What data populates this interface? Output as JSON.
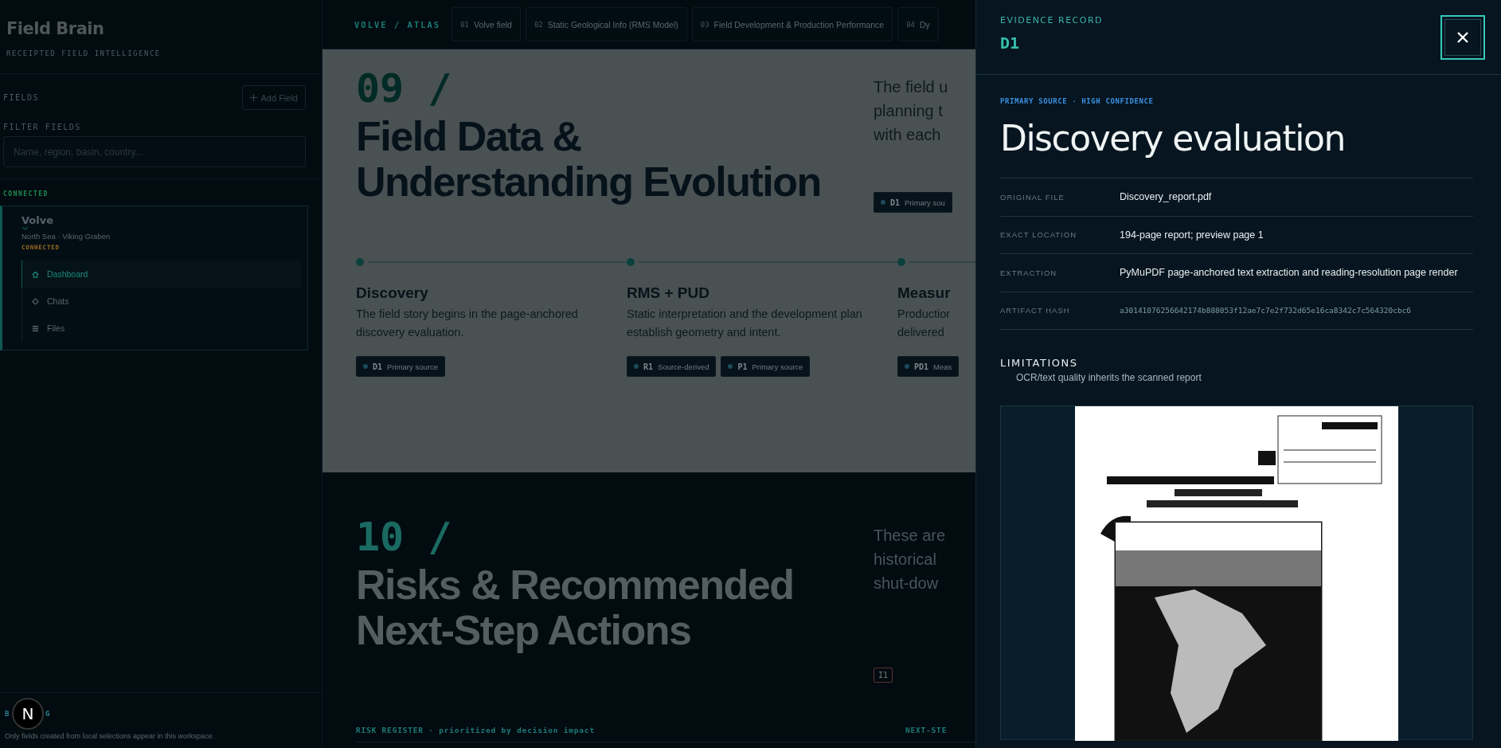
{
  "sidebar": {
    "brand": "Field Brain",
    "tagline": "RECEIPTED FIELD INTELLIGENCE",
    "fields_heading": "FIELDS",
    "add_button": "Add Field",
    "filter_label": "FILTER FIELDS",
    "filter": {
      "placeholder": "Name, region, basin, country..."
    },
    "group_label": "CONNECTED",
    "fields": [
      {
        "name": "Volve",
        "region": "North Sea · Viking Graben",
        "status": "CONNECTED",
        "expanded": true,
        "nav": [
          {
            "kind": "home",
            "label": "Dashboard",
            "selected": true
          },
          {
            "kind": "chat",
            "label": "Chats",
            "selected": false
          },
          {
            "kind": "files",
            "label": "Files",
            "selected": false
          }
        ]
      }
    ],
    "footer_label_parts": [
      "B",
      "G"
    ],
    "footer_note": "Only fields created from local selections appear in this workspace.",
    "dev_badge": "N"
  },
  "topbar": {
    "crumb": "VOLVE / ATLAS",
    "tabs": [
      {
        "num": "01",
        "label": "Volve field",
        "selected": false
      },
      {
        "num": "02",
        "label": "Static Geological Info (RMS Model)",
        "selected": false
      },
      {
        "num": "03",
        "label": "Field Development & Production Performance",
        "selected": false
      },
      {
        "num": "04",
        "label": "Dy",
        "selected": false
      }
    ]
  },
  "sections": [
    {
      "highlighted": true,
      "number": "09 /",
      "title": [
        "Field Data &",
        "Understanding Evolution"
      ],
      "aside": [
        "The field u",
        "planning t",
        "with each"
      ],
      "aside_badges": [
        {
          "kind": "source",
          "code": "D1",
          "label": "Primary sou"
        }
      ],
      "timeline": [
        {
          "title": "Discovery",
          "text": [
            "The field story begins in the page-anchored",
            "discovery evaluation."
          ],
          "badges": [
            {
              "code": "D1",
              "label": "Primary source"
            }
          ]
        },
        {
          "title": "RMS + PUD",
          "text": [
            "Static interpretation and the development plan",
            "establish geometry and intent."
          ],
          "badges": [
            {
              "code": "R1",
              "label": "Source-derived"
            },
            {
              "code": "P1",
              "label": "Primary source"
            }
          ]
        },
        {
          "title": "Measur",
          "text": [
            "Productior",
            "delivered"
          ],
          "badges": [
            {
              "code": "PD1",
              "label": "Meas"
            }
          ]
        }
      ]
    },
    {
      "highlighted": false,
      "number": "10 /",
      "title": [
        "Risks & Recommended",
        "Next-Step Actions"
      ],
      "aside": [
        "These are",
        "historical",
        "shut-dow"
      ],
      "aside_badges": [
        {
          "kind": "issue",
          "code": "I1"
        }
      ],
      "register_label": "RISK REGISTER · prioritized by decision impact",
      "next_label": "NEXT-STE"
    }
  ],
  "drawer": {
    "eyebrow": "EVIDENCE RECORD",
    "code": "D1",
    "tags": "PRIMARY SOURCE · HIGH CONFIDENCE",
    "title": "Discovery evaluation",
    "rows": [
      {
        "kind": "text",
        "label": "ORIGINAL FILE",
        "value": "Discovery_report.pdf"
      },
      {
        "kind": "text",
        "label": "EXACT LOCATION",
        "value": "194-page report; preview page 1"
      },
      {
        "kind": "text",
        "label": "EXTRACTION",
        "value": "PyMuPDF page-anchored text extraction and reading-resolution page render"
      },
      {
        "kind": "hash",
        "label": "ARTIFACT HASH",
        "value": "a30141076256642174b888053f12ae7c7e2f732d65e16ca8342c7c564320cbc6"
      }
    ],
    "limitations_heading": "LIMITATIONS",
    "limitations": [
      "OCR/text quality inherits the scanned report"
    ]
  }
}
